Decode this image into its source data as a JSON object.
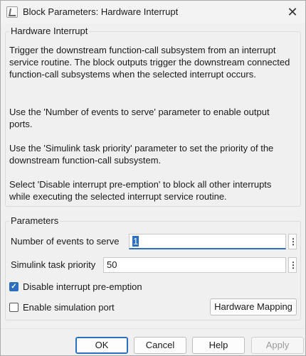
{
  "window": {
    "title": "Block Parameters: Hardware Interrupt",
    "close_glyph": "✕"
  },
  "description_group": {
    "title": "Hardware Interrupt",
    "paragraphs": [
      "Trigger the downstream function-call subsystem from an interrupt service routine. The block outputs trigger the downstream connected function-call subsystems when the selected interrupt occurs.",
      "Use the 'Number of events to serve' parameter to enable output ports.",
      "Use the 'Simulink task priority' parameter to set the priority of the downstream function-call subsystem.",
      "Select 'Disable interrupt pre-emption' to block all other interrupts while executing the selected interrupt service routine."
    ]
  },
  "parameters_group": {
    "title": "Parameters",
    "num_events_label": "Number of events to serve",
    "num_events_value": "1",
    "priority_label": "Simulink task priority",
    "priority_value": "50",
    "disable_preemption_label": "Disable interrupt pre-emption",
    "disable_preemption_checked": true,
    "enable_sim_port_label": "Enable simulation port",
    "enable_sim_port_checked": false,
    "hardware_mapping_label": "Hardware Mapping",
    "menu_glyph": "⋮",
    "check_glyph": "✓"
  },
  "footer": {
    "ok_label": "OK",
    "cancel_label": "Cancel",
    "help_label": "Help",
    "apply_label": "Apply"
  },
  "colors": {
    "accent": "#2b6fc3",
    "background": "#f0f0f0"
  }
}
